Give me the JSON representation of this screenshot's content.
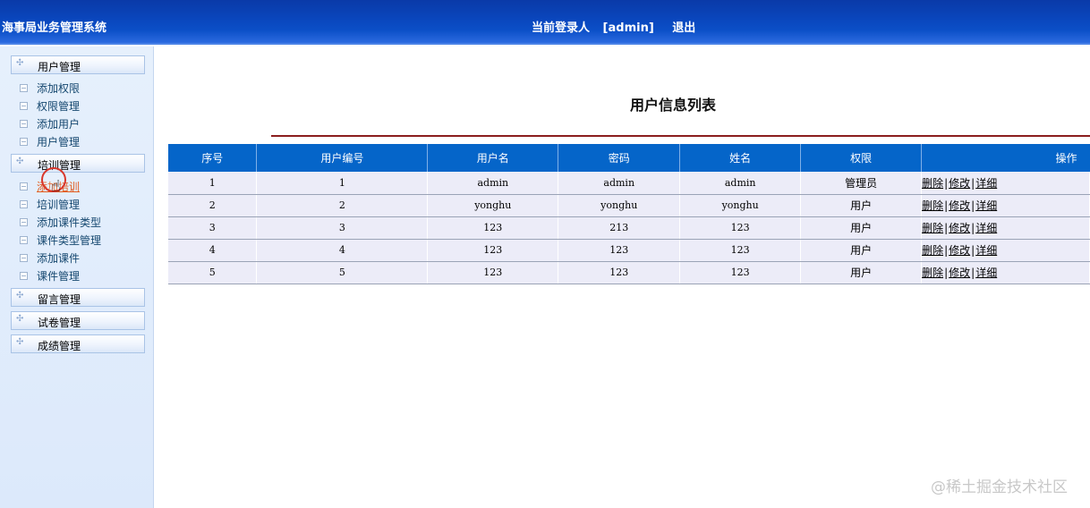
{
  "header": {
    "app_title": "海事局业务管理系统",
    "login_label": "当前登录人",
    "login_user": "[admin]",
    "logout": "退出"
  },
  "sidebar": {
    "groups": [
      {
        "label": "用户管理",
        "items": [
          "添加权限",
          "权限管理",
          "添加用户",
          "用户管理"
        ]
      },
      {
        "label": "培训管理",
        "items": [
          "添加培训",
          "培训管理",
          "添加课件类型",
          "课件类型管理",
          "添加课件",
          "课件管理"
        ]
      },
      {
        "label": "留言管理",
        "items": []
      },
      {
        "label": "试卷管理",
        "items": []
      },
      {
        "label": "成绩管理",
        "items": []
      }
    ]
  },
  "main": {
    "title": "用户信息列表",
    "columns": [
      "序号",
      "用户编号",
      "用户名",
      "密码",
      "姓名",
      "权限",
      "操作"
    ],
    "rows": [
      {
        "seq": "1",
        "code": "1",
        "username": "admin",
        "password": "admin",
        "name": "admin",
        "role": "管理员"
      },
      {
        "seq": "2",
        "code": "2",
        "username": "yonghu",
        "password": "yonghu",
        "name": "yonghu",
        "role": "用户"
      },
      {
        "seq": "3",
        "code": "3",
        "username": "123",
        "password": "213",
        "name": "123",
        "role": "用户"
      },
      {
        "seq": "4",
        "code": "4",
        "username": "123",
        "password": "123",
        "name": "123",
        "role": "用户"
      },
      {
        "seq": "5",
        "code": "5",
        "username": "123",
        "password": "123",
        "name": "123",
        "role": "用户"
      }
    ],
    "actions": {
      "delete": "删除",
      "edit": "修改",
      "detail": "详细",
      "separator": "|"
    }
  },
  "watermark": "@稀土掘金技术社区"
}
